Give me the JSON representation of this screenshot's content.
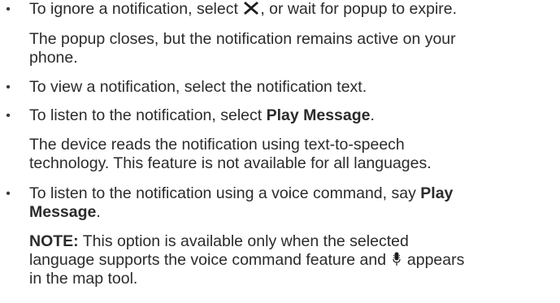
{
  "items": [
    {
      "bullet": "•",
      "prefix": "To ignore a notification, select",
      "icon": "close-x-icon",
      "suffix": ", or wait for popup to expire.",
      "note_lines": [
        "The popup closes, but the notification remains active on your",
        "phone."
      ]
    },
    {
      "bullet": "•",
      "text": "To view a notification, select the notification text."
    },
    {
      "bullet": "•",
      "prefix": "To listen to the notification, select ",
      "bold": "Play Message",
      "suffix": ".",
      "note_lines": [
        "The device reads the notification using text-to-speech",
        "technology. This feature is not available for all languages."
      ]
    },
    {
      "bullet": "•",
      "line1_prefix": "To listen to the notification using a voice command, say ",
      "line1_bold": "Play",
      "line2_bold": "Message",
      "line2_suffix": ".",
      "note_label": "NOTE:",
      "note_line1": " This option is available only when the selected",
      "note_line2_prefix": "language supports the voice command feature and ",
      "note_icon": "microphone-icon",
      "note_line2_suffix": " appears",
      "note_line3": "in the map tool."
    }
  ]
}
